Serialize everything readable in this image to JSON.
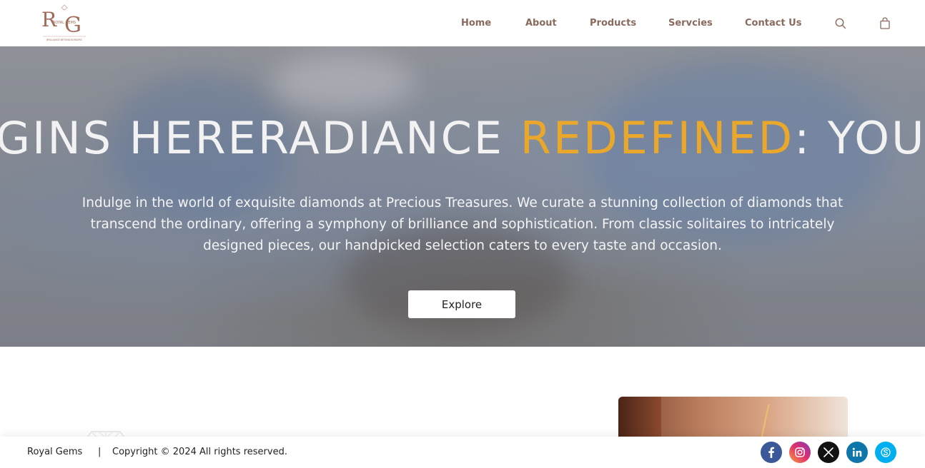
{
  "header": {
    "logo": {
      "name": "logo",
      "text_monogram": "RG",
      "text_brand": "ROYAL GEMS",
      "text_tagline": "BRILLIANCE BEYOND BORDERS"
    },
    "nav": [
      {
        "label": "Home"
      },
      {
        "label": "About"
      },
      {
        "label": "Products"
      },
      {
        "label": "Servcies"
      },
      {
        "label": "Contact Us"
      }
    ],
    "icons": [
      "search-icon",
      "cart-icon"
    ]
  },
  "hero": {
    "ticker_before": "GINS HERERADIANCE ",
    "ticker_accent": "REDEFINED",
    "ticker_after": ": YOUR JOU",
    "description": "Indulge in the world of exquisite diamonds at Precious Treasures. We curate a stunning collection of diamonds that transcend the ordinary, offering a symphony of brilliance and sophistication. From classic solitaires to intricately designed pieces, our handpicked selection caters to every taste and occasion.",
    "button_label": "Explore"
  },
  "footer": {
    "brand": "Royal Gems",
    "separator": "|",
    "copyright": "Copyright © 2024 All rights reserved.",
    "social": [
      "facebook-icon",
      "instagram-icon",
      "x-icon",
      "linkedin-icon",
      "skype-icon"
    ]
  },
  "colors": {
    "accent": "#e9a82c",
    "nav_text": "#8a6a5e",
    "logo": "#a06a58"
  }
}
